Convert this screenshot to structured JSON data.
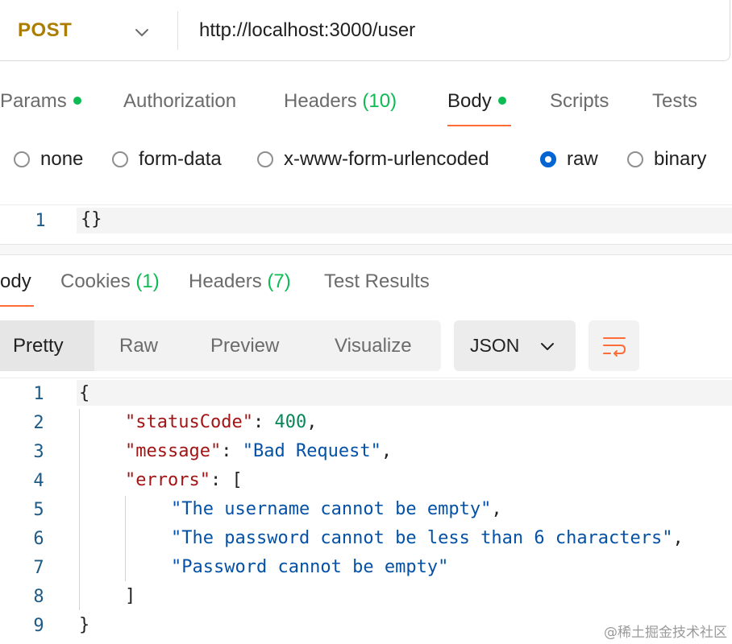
{
  "request": {
    "method": "POST",
    "url": "http://localhost:3000/user"
  },
  "request_tabs": [
    {
      "label": "Params",
      "has_dot": true
    },
    {
      "label": "Authorization"
    },
    {
      "label": "Headers",
      "count": "(10)"
    },
    {
      "label": "Body",
      "has_dot": true,
      "active": true
    },
    {
      "label": "Scripts"
    },
    {
      "label": "Tests"
    }
  ],
  "body_types": [
    {
      "label": "none",
      "checked": false
    },
    {
      "label": "form-data",
      "checked": false
    },
    {
      "label": "x-www-form-urlencoded",
      "checked": false
    },
    {
      "label": "raw",
      "checked": true
    },
    {
      "label": "binary",
      "checked": false
    }
  ],
  "request_body": {
    "lines": [
      {
        "num": "1",
        "text": "{}"
      }
    ]
  },
  "response_tabs": [
    {
      "label": "ody",
      "active": true
    },
    {
      "label": "Cookies",
      "count": "(1)"
    },
    {
      "label": "Headers",
      "count": "(7)"
    },
    {
      "label": "Test Results"
    }
  ],
  "view_modes": [
    "Pretty",
    "Raw",
    "Preview",
    "Visualize"
  ],
  "active_view": "Pretty",
  "format": "JSON",
  "response_body": {
    "line_numbers": [
      "1",
      "2",
      "3",
      "4",
      "5",
      "6",
      "7",
      "8",
      "9"
    ],
    "lines": [
      "{",
      "    \"statusCode\": 400,",
      "    \"message\": \"Bad Request\",",
      "    \"errors\": [",
      "        \"The username cannot be empty\",",
      "        \"The password cannot be less than 6 characters\",",
      "        \"Password cannot be empty\"",
      "    ]",
      "}"
    ],
    "tokens": {
      "open_brace": "{",
      "k1": "\"statusCode\"",
      "v1": "400",
      "k2": "\"message\"",
      "v2": "\"Bad Request\"",
      "k3": "\"errors\"",
      "open_bracket": "[",
      "e1": "\"The username cannot be empty\"",
      "e2": "\"The password cannot be less than 6 characters\"",
      "e3": "\"Password cannot be empty\"",
      "close_bracket": "]",
      "close_brace": "}"
    }
  },
  "watermark": "@稀土掘金技术社区",
  "colors": {
    "method": "#ab7d00",
    "accent": "#ff6c37",
    "count_green": "#0cbb52",
    "radio_checked": "#0265d2",
    "json_key": "#a31515",
    "json_string": "#0451a5",
    "json_number": "#098658"
  },
  "icons": {
    "method_dropdown": "chevron-down-icon",
    "format_dropdown": "chevron-down-icon",
    "wrap": "wrap-lines-icon"
  }
}
